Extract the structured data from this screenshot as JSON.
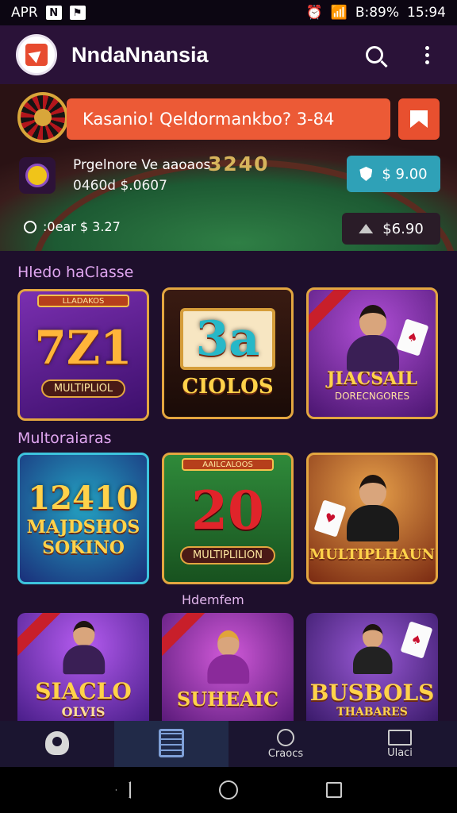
{
  "status_bar": {
    "left_text": "APR",
    "left_icon_1": "N",
    "left_icon_2": "alert-icon",
    "battery": "89%",
    "prefix": "B:",
    "time": "15:94"
  },
  "app_bar": {
    "title": "NndaNnansia",
    "search_icon": "search-icon",
    "menu_icon": "more-vert-icon"
  },
  "hero": {
    "promo_text": "Kasanio! Qeldormankbo? 3-84",
    "bonus_title": "Prgelnore Ve aaoaos",
    "bonus_sub": "0460d $.0607",
    "felt_text": "3240",
    "teal_button": "9.00",
    "teal_prefix": "$",
    "dark_button": "$6.90",
    "balance": ":0ear $ 3.27"
  },
  "sections": {
    "section_1_title": "Hledo haClasse",
    "section_2_title": "Multoraiaras",
    "mid_label": "Hdemfem"
  },
  "tiles": {
    "t1": {
      "strip": "LLADAKOS",
      "big": "7Z1",
      "pill": "MULTIPLIOL"
    },
    "t2": {
      "big": "3a",
      "label": "CIOLOS"
    },
    "t3": {
      "label": "JIACSAIL",
      "sub": "DORECNGORES"
    },
    "t4": {
      "big": "12410",
      "label1": "MAJDSHOS",
      "label2": "SOKINO"
    },
    "t5": {
      "strip": "AAILCALOOS",
      "big": "20",
      "pill": "MULTIPLILION"
    },
    "t6": {
      "label": "MULTIPLHAUN"
    },
    "t7": {
      "label1": "SIACLO",
      "label2": "OLVIS"
    },
    "t8": {
      "label": "SUHEAIC"
    },
    "t9": {
      "label1": "BUSBOLS",
      "label2": "THABARES"
    }
  },
  "bottom_nav": {
    "items": [
      {
        "label": "",
        "icon": "profile-icon"
      },
      {
        "label": "",
        "icon": "grid-icon"
      },
      {
        "label": "Craocs",
        "icon": "search-icon"
      },
      {
        "label": "Ulaci",
        "icon": "screen-icon"
      }
    ]
  },
  "colors": {
    "accent": "#ec5a36",
    "teal": "#2fa1b7",
    "background": "#1e0f2c",
    "gold": "#ffd24a"
  }
}
